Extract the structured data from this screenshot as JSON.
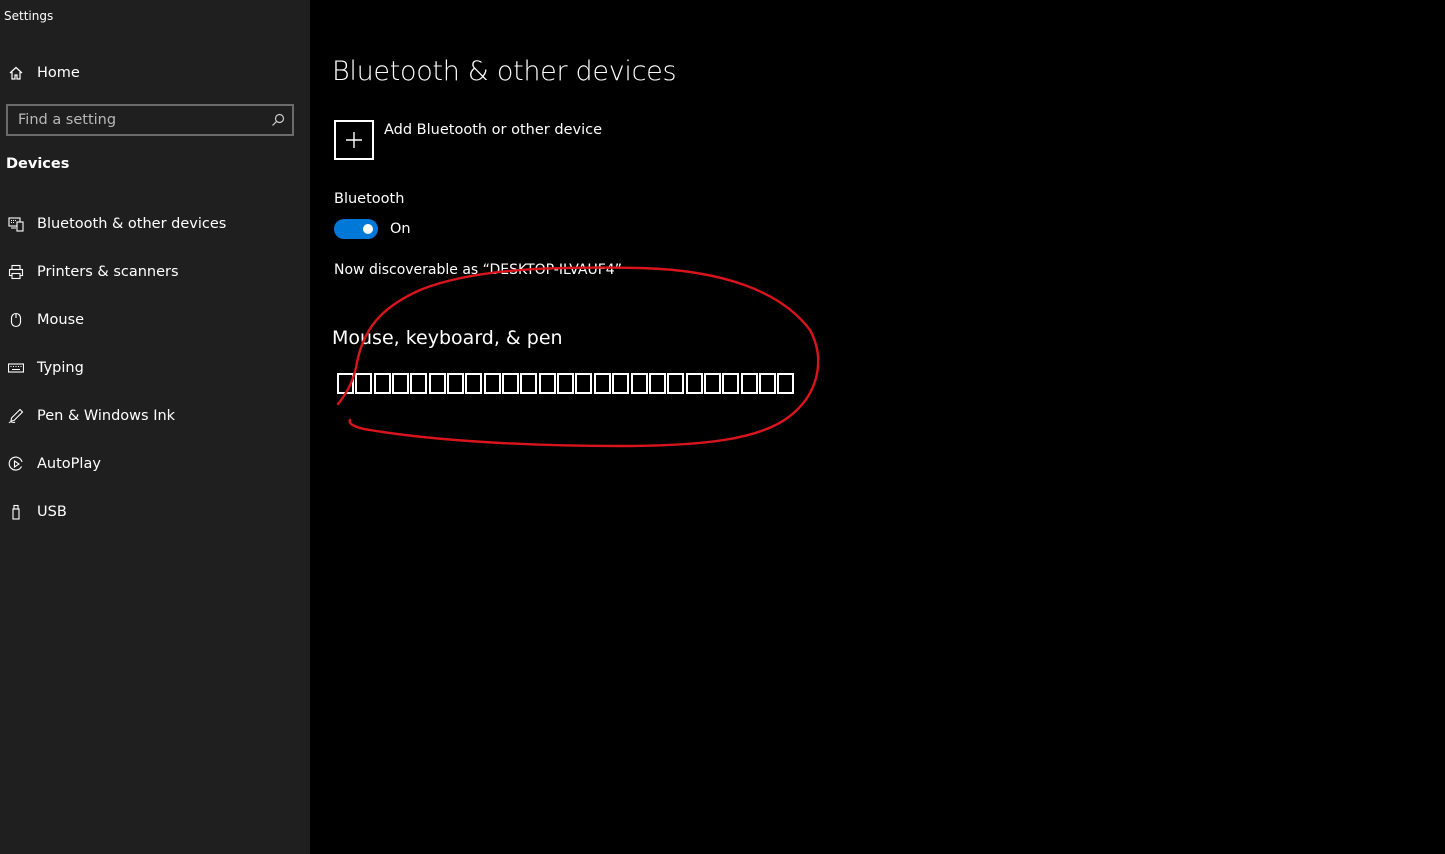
{
  "window": {
    "title": "Settings"
  },
  "sidebar": {
    "home_label": "Home",
    "search": {
      "placeholder": "Find a setting",
      "value": ""
    },
    "section_heading": "Devices",
    "items": [
      {
        "label": "Bluetooth & other devices",
        "icon": "bluetooth-devices-icon"
      },
      {
        "label": "Printers & scanners",
        "icon": "printer-icon"
      },
      {
        "label": "Mouse",
        "icon": "mouse-icon"
      },
      {
        "label": "Typing",
        "icon": "keyboard-icon"
      },
      {
        "label": "Pen & Windows Ink",
        "icon": "pen-icon"
      },
      {
        "label": "AutoPlay",
        "icon": "autoplay-icon"
      },
      {
        "label": "USB",
        "icon": "usb-icon"
      }
    ]
  },
  "main": {
    "title": "Bluetooth & other devices",
    "add_device_label": "Add Bluetooth or other device",
    "bluetooth_label": "Bluetooth",
    "bluetooth_state": "On",
    "bluetooth_on": true,
    "discoverable_text": "Now discoverable as “DESKTOP-ILVAUF4”",
    "section_heading": "Mouse, keyboard, & pen",
    "missing_glyph_count": 25
  },
  "colors": {
    "sidebar_bg": "#1f1f1f",
    "main_bg": "#000000",
    "accent": "#0078d7",
    "annotation": "#d9141c"
  }
}
